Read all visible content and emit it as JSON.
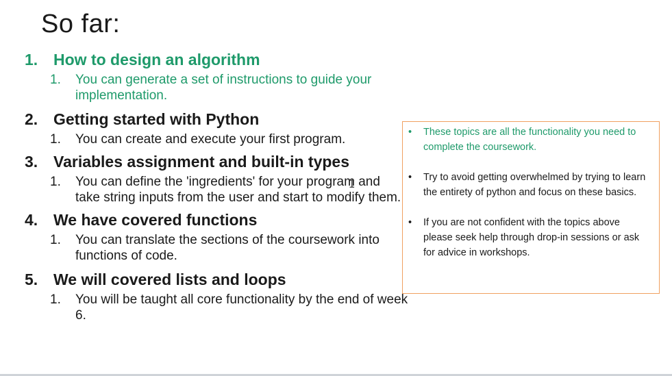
{
  "slide": {
    "title": "So far:"
  },
  "topics": [
    {
      "number": "1.",
      "heading": "How to design an algorithm",
      "sub_number": "1.",
      "sub_text": "You can generate a set of instructions to guide your implementation."
    },
    {
      "number": "2.",
      "heading": "Getting started with Python",
      "sub_number": "1.",
      "sub_text": "You can create and execute your first program."
    },
    {
      "number": "3.",
      "heading": "Variables assignment and built-in types",
      "sub_number": "1.",
      "sub_text": "You can define the 'ingredients' for your program and take string inputs from the user and start to modify them."
    },
    {
      "number": "4.",
      "heading": "We have covered functions",
      "sub_number": "1.",
      "sub_text": "You can translate the sections of the coursework into functions of code."
    },
    {
      "number": "5.",
      "heading": "We will covered lists and loops",
      "sub_number": "1.",
      "sub_text": "You will be taught all core functionality by the end of week 6."
    }
  ],
  "notes": [
    {
      "bullet": "•",
      "text": "These topics are all the functionality you need to complete the coursework."
    },
    {
      "bullet": "•",
      "text": "Try to avoid getting overwhelmed by trying to learn the entirety of python and focus on these basics."
    },
    {
      "bullet": "•",
      "text": "If you are not confident with the topics above please seek help through drop-in sessions or ask for advice in workshops."
    }
  ],
  "colors": {
    "highlight_green": "#1e9a6a",
    "box_border": "#f0a060",
    "text": "#1a1a1a"
  },
  "cursor": {
    "icon": "text-cursor-icon",
    "glyph": "I"
  }
}
